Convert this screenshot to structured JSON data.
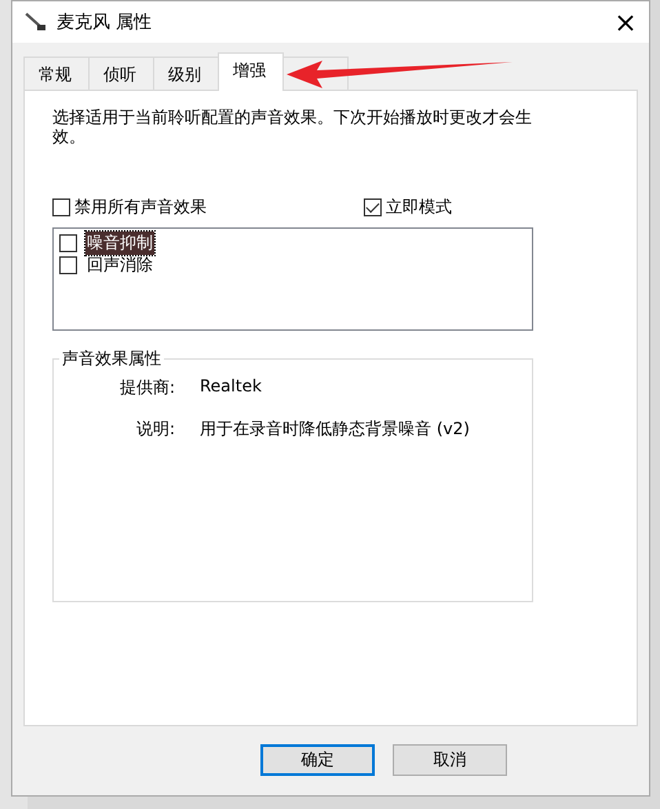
{
  "window": {
    "title": "麦克风 属性",
    "close": "×"
  },
  "tabs": [
    {
      "label": "常规",
      "selected": false
    },
    {
      "label": "侦听",
      "selected": false
    },
    {
      "label": "级别",
      "selected": false
    },
    {
      "label": "增强",
      "selected": true
    },
    {
      "selected": false
    }
  ],
  "description": "选择适用于当前聆听配置的声音效果。下次开始播放时更改才会生效。",
  "options": [
    {
      "label": "禁用所有声音效果",
      "checked": false
    },
    {
      "label": "立即模式",
      "checked": true
    }
  ],
  "effects": [
    {
      "label": "噪音抑制",
      "checked": false,
      "selected": true
    },
    {
      "label": "回声消除",
      "checked": false,
      "selected": false
    }
  ],
  "properties": {
    "title": "声音效果属性",
    "rows": [
      {
        "label": "提供商:",
        "value": "Realtek"
      },
      {
        "label": "说明:",
        "value": "用于在录音时降低静态背景噪音 (v2)"
      }
    ]
  },
  "buttons": [
    {
      "label": "确定",
      "default": true
    },
    {
      "label": "取消",
      "default": false
    }
  ]
}
